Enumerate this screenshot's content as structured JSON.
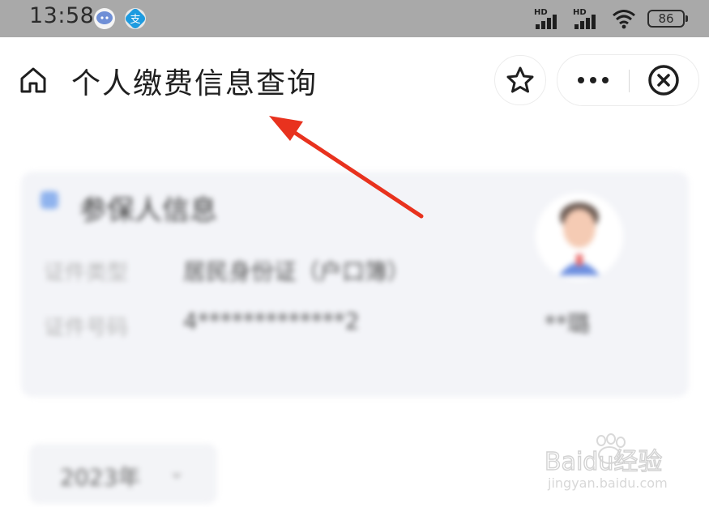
{
  "status_bar": {
    "time": "13:58",
    "signal_1_label": "HD",
    "signal_2_label": "HD",
    "battery": "86"
  },
  "title_bar": {
    "title": "个人缴费信息查询"
  },
  "card": {
    "heading": "参保人信息",
    "rows": [
      {
        "label": "证件类型",
        "value": "居民身份证（户口簿）"
      },
      {
        "label": "证件号码",
        "value": "4*************2"
      }
    ],
    "person_name": "**璐"
  },
  "filter": {
    "year": "2023年",
    "chevron": "⌄"
  },
  "watermark": {
    "brand": "Baidu经验",
    "url": "jingyan.baidu.com"
  },
  "colors": {
    "status_bar_bg": "#a9a9a9",
    "arrow": "#e8321e",
    "card_bg": "#f3f4f8"
  }
}
